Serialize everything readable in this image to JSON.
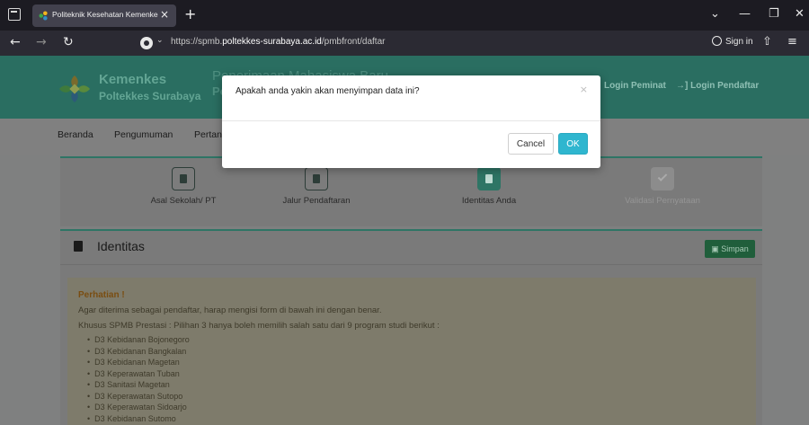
{
  "browser": {
    "tab_title": "Politeknik Kesehatan Kemenkes",
    "tab_close": "×",
    "new_tab": "+",
    "url_prefix": "https://spmb.",
    "url_domain": "poltekkes-surabaya.ac.id",
    "url_path": "/pmbfront/daftar",
    "sign_in": "Sign in",
    "icons": [
      "tab-list-icon",
      "back-arrow-icon",
      "forward-arrow-icon",
      "reload-icon",
      "site-info-icon",
      "share-icon",
      "menu-icon",
      "minimize-icon",
      "maximize-icon",
      "close-icon"
    ]
  },
  "header": {
    "brand_line1": "Kemenkes",
    "brand_line2": "Poltekkes Surabaya",
    "title_line1": "Penerimaan Mahasiswa Baru",
    "title_line2": "Po",
    "login_peminat": "Login Peminat",
    "login_pendaftar": "Login Pendaftar",
    "login_pendaftar_glyph": "→]"
  },
  "menu": {
    "items": [
      "Beranda",
      "Pengumuman",
      "Pertany"
    ]
  },
  "steps": [
    {
      "label": "Asal Sekolah/ PT",
      "state": "done"
    },
    {
      "label": "Jalur Pendaftaran",
      "state": "done"
    },
    {
      "label": "Identitas Anda",
      "state": "active"
    },
    {
      "label": "Validasi Pernyataan",
      "state": "disabled"
    }
  ],
  "identitas": {
    "title": "Identitas",
    "save_label": "Simpan",
    "notice_title": "Perhatian !",
    "notice_line1": "Agar diterima sebagai pendaftar, harap mengisi form di bawah ini dengan benar.",
    "notice_line2": "Khusus SPMB Prestasi : Pilihan 3 hanya boleh memilih salah satu dari 9 program studi berikut :",
    "programs": [
      "D3 Kebidanan Bojonegoro",
      "D3 Kebidanan Bangkalan",
      "D3 Kebidanan Magetan",
      "D3 Keperawatan Tuban",
      "D3 Sanitasi Magetan",
      "D3 Keperawatan Sutopo",
      "D3 Keperawatan Sidoarjo",
      "D3 Kebidanan Sutomo"
    ]
  },
  "modal": {
    "message": "Apakah anda yakin akan menyimpan data ini?",
    "close_glyph": "×",
    "cancel_label": "Cancel",
    "ok_label": "OK"
  },
  "colors": {
    "header_teal": "#2a6e61",
    "ok_button": "#2fb6cf",
    "save_button": "#205e3b",
    "overlay_gray": "#7f8080"
  }
}
